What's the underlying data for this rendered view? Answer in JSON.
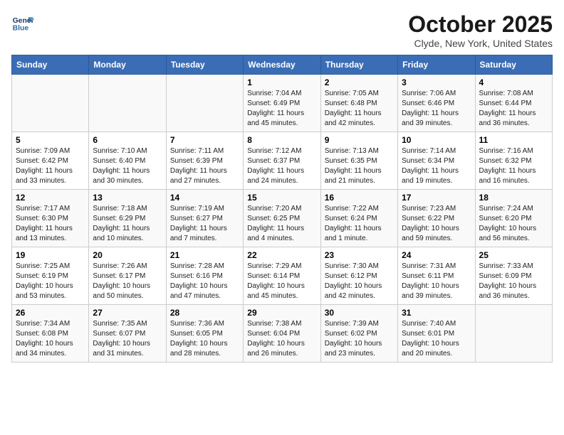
{
  "header": {
    "logo_line1": "General",
    "logo_line2": "Blue",
    "month": "October 2025",
    "location": "Clyde, New York, United States"
  },
  "weekdays": [
    "Sunday",
    "Monday",
    "Tuesday",
    "Wednesday",
    "Thursday",
    "Friday",
    "Saturday"
  ],
  "weeks": [
    [
      {
        "day": "",
        "info": ""
      },
      {
        "day": "",
        "info": ""
      },
      {
        "day": "",
        "info": ""
      },
      {
        "day": "1",
        "info": "Sunrise: 7:04 AM\nSunset: 6:49 PM\nDaylight: 11 hours\nand 45 minutes."
      },
      {
        "day": "2",
        "info": "Sunrise: 7:05 AM\nSunset: 6:48 PM\nDaylight: 11 hours\nand 42 minutes."
      },
      {
        "day": "3",
        "info": "Sunrise: 7:06 AM\nSunset: 6:46 PM\nDaylight: 11 hours\nand 39 minutes."
      },
      {
        "day": "4",
        "info": "Sunrise: 7:08 AM\nSunset: 6:44 PM\nDaylight: 11 hours\nand 36 minutes."
      }
    ],
    [
      {
        "day": "5",
        "info": "Sunrise: 7:09 AM\nSunset: 6:42 PM\nDaylight: 11 hours\nand 33 minutes."
      },
      {
        "day": "6",
        "info": "Sunrise: 7:10 AM\nSunset: 6:40 PM\nDaylight: 11 hours\nand 30 minutes."
      },
      {
        "day": "7",
        "info": "Sunrise: 7:11 AM\nSunset: 6:39 PM\nDaylight: 11 hours\nand 27 minutes."
      },
      {
        "day": "8",
        "info": "Sunrise: 7:12 AM\nSunset: 6:37 PM\nDaylight: 11 hours\nand 24 minutes."
      },
      {
        "day": "9",
        "info": "Sunrise: 7:13 AM\nSunset: 6:35 PM\nDaylight: 11 hours\nand 21 minutes."
      },
      {
        "day": "10",
        "info": "Sunrise: 7:14 AM\nSunset: 6:34 PM\nDaylight: 11 hours\nand 19 minutes."
      },
      {
        "day": "11",
        "info": "Sunrise: 7:16 AM\nSunset: 6:32 PM\nDaylight: 11 hours\nand 16 minutes."
      }
    ],
    [
      {
        "day": "12",
        "info": "Sunrise: 7:17 AM\nSunset: 6:30 PM\nDaylight: 11 hours\nand 13 minutes."
      },
      {
        "day": "13",
        "info": "Sunrise: 7:18 AM\nSunset: 6:29 PM\nDaylight: 11 hours\nand 10 minutes."
      },
      {
        "day": "14",
        "info": "Sunrise: 7:19 AM\nSunset: 6:27 PM\nDaylight: 11 hours\nand 7 minutes."
      },
      {
        "day": "15",
        "info": "Sunrise: 7:20 AM\nSunset: 6:25 PM\nDaylight: 11 hours\nand 4 minutes."
      },
      {
        "day": "16",
        "info": "Sunrise: 7:22 AM\nSunset: 6:24 PM\nDaylight: 11 hours\nand 1 minute."
      },
      {
        "day": "17",
        "info": "Sunrise: 7:23 AM\nSunset: 6:22 PM\nDaylight: 10 hours\nand 59 minutes."
      },
      {
        "day": "18",
        "info": "Sunrise: 7:24 AM\nSunset: 6:20 PM\nDaylight: 10 hours\nand 56 minutes."
      }
    ],
    [
      {
        "day": "19",
        "info": "Sunrise: 7:25 AM\nSunset: 6:19 PM\nDaylight: 10 hours\nand 53 minutes."
      },
      {
        "day": "20",
        "info": "Sunrise: 7:26 AM\nSunset: 6:17 PM\nDaylight: 10 hours\nand 50 minutes."
      },
      {
        "day": "21",
        "info": "Sunrise: 7:28 AM\nSunset: 6:16 PM\nDaylight: 10 hours\nand 47 minutes."
      },
      {
        "day": "22",
        "info": "Sunrise: 7:29 AM\nSunset: 6:14 PM\nDaylight: 10 hours\nand 45 minutes."
      },
      {
        "day": "23",
        "info": "Sunrise: 7:30 AM\nSunset: 6:12 PM\nDaylight: 10 hours\nand 42 minutes."
      },
      {
        "day": "24",
        "info": "Sunrise: 7:31 AM\nSunset: 6:11 PM\nDaylight: 10 hours\nand 39 minutes."
      },
      {
        "day": "25",
        "info": "Sunrise: 7:33 AM\nSunset: 6:09 PM\nDaylight: 10 hours\nand 36 minutes."
      }
    ],
    [
      {
        "day": "26",
        "info": "Sunrise: 7:34 AM\nSunset: 6:08 PM\nDaylight: 10 hours\nand 34 minutes."
      },
      {
        "day": "27",
        "info": "Sunrise: 7:35 AM\nSunset: 6:07 PM\nDaylight: 10 hours\nand 31 minutes."
      },
      {
        "day": "28",
        "info": "Sunrise: 7:36 AM\nSunset: 6:05 PM\nDaylight: 10 hours\nand 28 minutes."
      },
      {
        "day": "29",
        "info": "Sunrise: 7:38 AM\nSunset: 6:04 PM\nDaylight: 10 hours\nand 26 minutes."
      },
      {
        "day": "30",
        "info": "Sunrise: 7:39 AM\nSunset: 6:02 PM\nDaylight: 10 hours\nand 23 minutes."
      },
      {
        "day": "31",
        "info": "Sunrise: 7:40 AM\nSunset: 6:01 PM\nDaylight: 10 hours\nand 20 minutes."
      },
      {
        "day": "",
        "info": ""
      }
    ]
  ]
}
